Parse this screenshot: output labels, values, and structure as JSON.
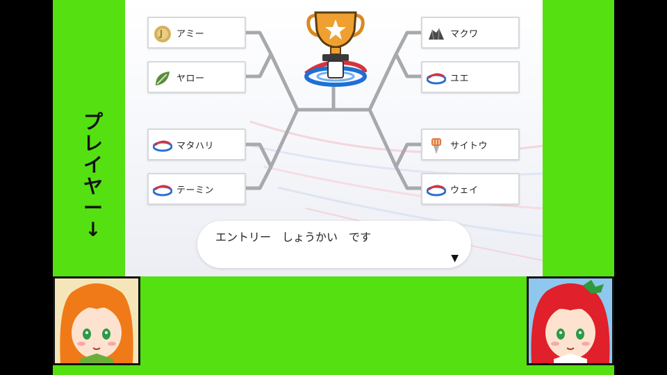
{
  "bracket": {
    "left": [
      {
        "name": "アミー",
        "emblem": "gym-emblem-gold-icon"
      },
      {
        "name": "ヤロー",
        "emblem": "grass-leaf-emblem-icon"
      },
      {
        "name": "マタハリ",
        "emblem": "league-logo-icon"
      },
      {
        "name": "テーミン",
        "emblem": "league-logo-icon"
      }
    ],
    "right": [
      {
        "name": "マクワ",
        "emblem": "rock-emblem-icon"
      },
      {
        "name": "ユエ",
        "emblem": "league-logo-icon"
      },
      {
        "name": "サイトウ",
        "emblem": "fist-emblem-icon"
      },
      {
        "name": "ウェイ",
        "emblem": "league-logo-icon"
      }
    ]
  },
  "trophy": {
    "icon": "trophy-star-icon",
    "logo": "league-swirl-logo-icon"
  },
  "message": {
    "text": "エントリー　しょうかい　です",
    "continue_icon": "down-triangle-icon"
  },
  "overlay": {
    "player_label": "プレイヤー↓"
  },
  "portraits": {
    "left": "orange-haired-girl-avatar",
    "right": "red-haired-girl-avatar"
  },
  "colors": {
    "chroma_green": "#55e012",
    "bracket_line": "#a7a9ad",
    "trophy_orange": "#f0a030"
  }
}
